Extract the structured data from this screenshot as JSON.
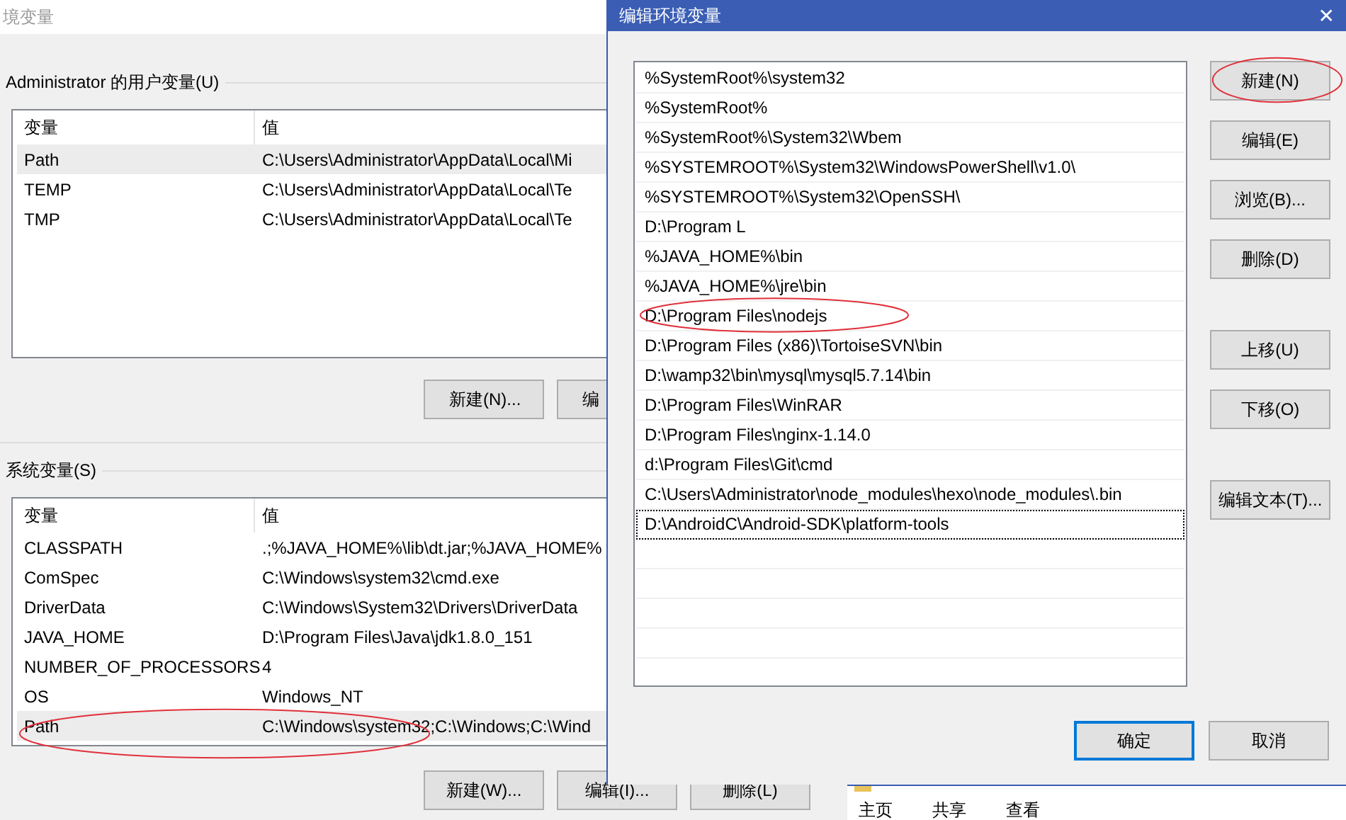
{
  "background_window": {
    "title": "境变量",
    "user_group": {
      "label": "Administrator 的用户变量(U)",
      "columns": [
        "变量",
        "值"
      ],
      "rows": [
        {
          "variable": "Path",
          "value": "C:\\Users\\Administrator\\AppData\\Local\\Mi",
          "selected": true,
          "circled": false
        },
        {
          "variable": "TEMP",
          "value": "C:\\Users\\Administrator\\AppData\\Local\\Te",
          "selected": false,
          "circled": false
        },
        {
          "variable": "TMP",
          "value": "C:\\Users\\Administrator\\AppData\\Local\\Te",
          "selected": false,
          "circled": false
        }
      ],
      "buttons": [
        {
          "label": "新建(N)..."
        },
        {
          "label": "编"
        }
      ]
    },
    "system_group": {
      "label": "系统变量(S)",
      "columns": [
        "变量",
        "值"
      ],
      "rows": [
        {
          "variable": "CLASSPATH",
          "value": ".;%JAVA_HOME%\\lib\\dt.jar;%JAVA_HOME%",
          "selected": false,
          "circled": false
        },
        {
          "variable": "ComSpec",
          "value": "C:\\Windows\\system32\\cmd.exe",
          "selected": false,
          "circled": false
        },
        {
          "variable": "DriverData",
          "value": "C:\\Windows\\System32\\Drivers\\DriverData",
          "selected": false,
          "circled": false
        },
        {
          "variable": "JAVA_HOME",
          "value": "D:\\Program Files\\Java\\jdk1.8.0_151",
          "selected": false,
          "circled": false
        },
        {
          "variable": "NUMBER_OF_PROCESSORS",
          "value": "4",
          "selected": false,
          "circled": false
        },
        {
          "variable": "OS",
          "value": "Windows_NT",
          "selected": false,
          "circled": false
        },
        {
          "variable": "Path",
          "value": "C:\\Windows\\system32;C:\\Windows;C:\\Wind",
          "selected": true,
          "circled": true
        }
      ],
      "buttons": [
        {
          "label": "新建(W)..."
        },
        {
          "label": "编辑(I)..."
        },
        {
          "label": "删除(L)"
        }
      ]
    }
  },
  "dialog": {
    "title": "编辑环境变量",
    "close": "✕",
    "entries": [
      {
        "text": "%SystemRoot%\\system32",
        "selected": false,
        "circled": false
      },
      {
        "text": "%SystemRoot%",
        "selected": false,
        "circled": false
      },
      {
        "text": "%SystemRoot%\\System32\\Wbem",
        "selected": false,
        "circled": false
      },
      {
        "text": "%SYSTEMROOT%\\System32\\WindowsPowerShell\\v1.0\\",
        "selected": false,
        "circled": false
      },
      {
        "text": "%SYSTEMROOT%\\System32\\OpenSSH\\",
        "selected": false,
        "circled": false
      },
      {
        "text": "D:\\Program L",
        "selected": false,
        "circled": false
      },
      {
        "text": "%JAVA_HOME%\\bin",
        "selected": false,
        "circled": false
      },
      {
        "text": "%JAVA_HOME%\\jre\\bin",
        "selected": false,
        "circled": false
      },
      {
        "text": "D:\\Program Files\\nodejs",
        "selected": false,
        "circled": true
      },
      {
        "text": "D:\\Program Files (x86)\\TortoiseSVN\\bin",
        "selected": false,
        "circled": false
      },
      {
        "text": "D:\\wamp32\\bin\\mysql\\mysql5.7.14\\bin",
        "selected": false,
        "circled": false
      },
      {
        "text": "D:\\Program Files\\WinRAR",
        "selected": false,
        "circled": false
      },
      {
        "text": "D:\\Program Files\\nginx-1.14.0",
        "selected": false,
        "circled": false
      },
      {
        "text": "d:\\Program Files\\Git\\cmd",
        "selected": false,
        "circled": false
      },
      {
        "text": "C:\\Users\\Administrator\\node_modules\\hexo\\node_modules\\.bin",
        "selected": false,
        "circled": false
      },
      {
        "text": "D:\\AndroidC\\Android-SDK\\platform-tools",
        "selected": true,
        "circled": false
      }
    ],
    "side_button_groups": [
      [
        {
          "label": "新建(N)",
          "circled": true
        },
        {
          "label": "编辑(E)",
          "circled": false
        },
        {
          "label": "浏览(B)...",
          "circled": false
        },
        {
          "label": "删除(D)",
          "circled": false
        }
      ],
      [
        {
          "label": "上移(U)",
          "circled": false
        },
        {
          "label": "下移(O)",
          "circled": false
        }
      ],
      [
        {
          "label": "编辑文本(T)...",
          "circled": false
        }
      ]
    ],
    "footer_buttons": [
      {
        "label": "确定",
        "default": true
      },
      {
        "label": "取消",
        "default": false
      }
    ]
  },
  "explorer": {
    "tabs": [
      "主页",
      "共享",
      "查看"
    ]
  }
}
